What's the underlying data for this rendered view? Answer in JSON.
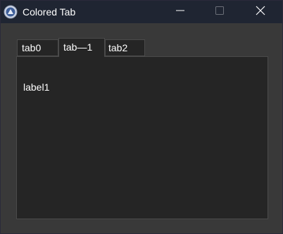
{
  "window": {
    "title": "Colored Tab",
    "icon": "app-logo-icon",
    "controls": [
      "minimize-icon",
      "maximize-icon",
      "close-icon"
    ]
  },
  "tabs": [
    {
      "label": "tab0",
      "selected": false
    },
    {
      "label": "tab—1",
      "selected": true
    },
    {
      "label": "tab2",
      "selected": false
    }
  ],
  "panel": {
    "label": "label1"
  },
  "colors": {
    "titlebar": "#1f2532",
    "window_bg": "#393939",
    "panel_bg": "#252525",
    "tab_border": "#4a4a4a",
    "text": "#ffffff"
  }
}
